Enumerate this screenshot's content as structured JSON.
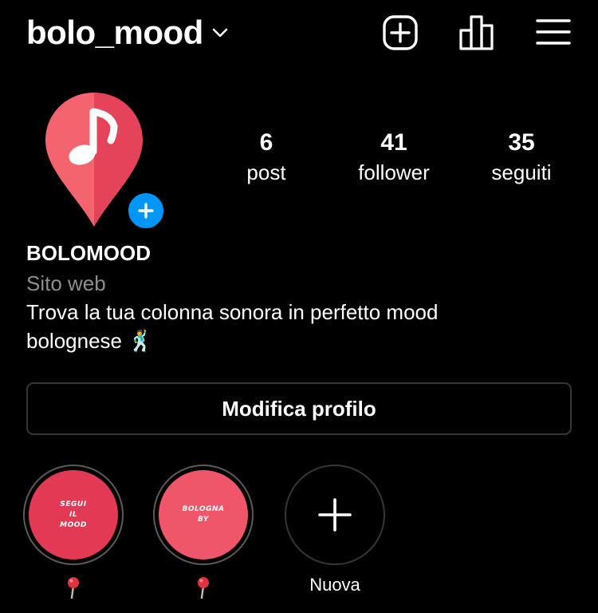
{
  "header": {
    "username": "bolo_mood",
    "new_post_icon": "plus-square-icon",
    "insights_icon": "bar-chart-icon",
    "menu_icon": "hamburger-menu-icon"
  },
  "profile": {
    "avatar_icon": "map-pin-music-note-icon",
    "stats": [
      {
        "value": "6",
        "label": "post"
      },
      {
        "value": "41",
        "label": "follower"
      },
      {
        "value": "35",
        "label": "seguiti"
      }
    ],
    "name": "BOLOMOOD",
    "website": "Sito web",
    "bio": "Trova la tua colonna sonora in perfetto mood bolognese 🕺",
    "edit_button": "Modifica profilo"
  },
  "highlights": [
    {
      "title_lines": [
        "SEGUI",
        "IL",
        "MOOD"
      ],
      "caption_icon": "round-pushpin-icon",
      "caption": "📍",
      "color": "#e23a55"
    },
    {
      "title_lines": [
        "BOLOGNA",
        "BY"
      ],
      "caption_icon": "round-pushpin-icon",
      "caption": "📍",
      "color": "#f0566a"
    }
  ],
  "new_highlight": {
    "label": "Nuova"
  },
  "colors": {
    "accent_blue": "#0095f6",
    "pin_light": "#f4646f",
    "pin_dark": "#e4435a",
    "muted_text": "#8e8e8e",
    "border": "#363636"
  }
}
